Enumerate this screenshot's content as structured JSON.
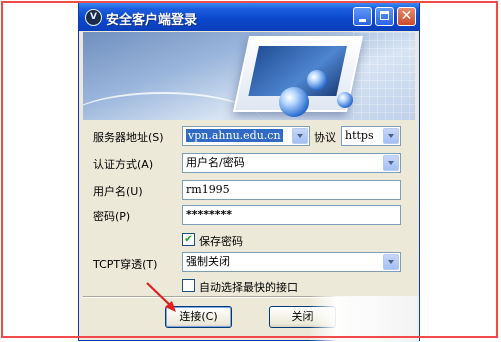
{
  "window": {
    "title": "安全客户端登录"
  },
  "form": {
    "server_label": "服务器地址(S)",
    "server_value": "vpn.ahnu.edu.cn",
    "protocol_label": "协议",
    "protocol_value": "https",
    "auth_label": "认证方式(A)",
    "auth_value": "用户名/密码",
    "username_label": "用户名(U)",
    "username_value": "rm1995",
    "password_label": "密码(P)",
    "password_value": "********",
    "save_password_label": "保存密码",
    "save_password_checked": true,
    "tcpt_label": "TCPT穿透(T)",
    "tcpt_value": "强制关闭",
    "auto_select_label": "自动选择最快的接口",
    "auto_select_checked": false
  },
  "buttons": {
    "connect": "连接(C)",
    "close": "关闭"
  },
  "colors": {
    "annotation_red": "#f04a4a",
    "titlebar_blue": "#0b47cc",
    "selection_blue": "#316ac5"
  }
}
